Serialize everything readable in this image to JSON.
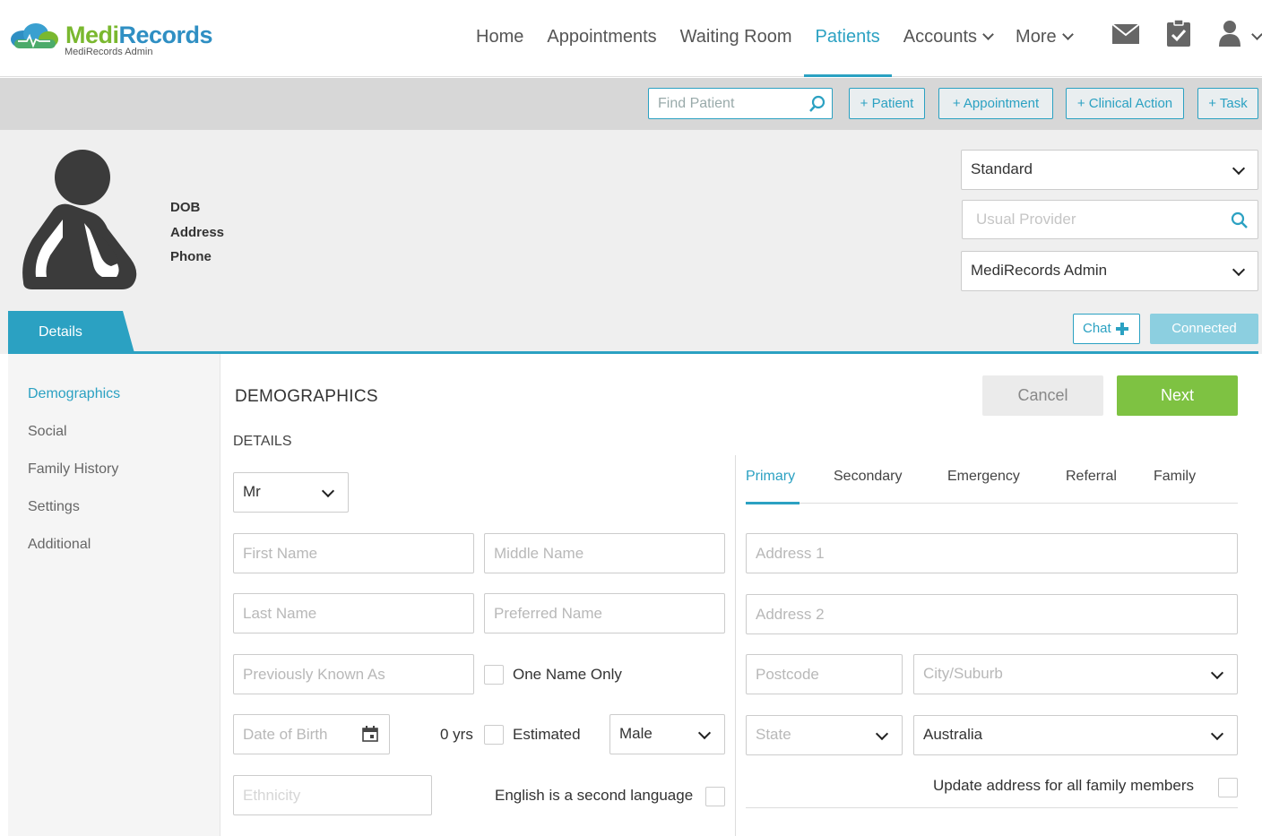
{
  "brand": {
    "name_part1": "Medi",
    "name_part2": "Records",
    "subtitle": "MediRecords Admin"
  },
  "nav": {
    "home": "Home",
    "appointments": "Appointments",
    "waiting_room": "Waiting Room",
    "patients": "Patients",
    "accounts": "Accounts",
    "more": "More",
    "active": "Patients"
  },
  "actions": {
    "find_placeholder": "Find Patient",
    "add_patient": "+ Patient",
    "add_appointment": "+ Appointment",
    "add_clinical_action": "+ Clinical Action",
    "add_task": "+ Task"
  },
  "patient": {
    "dob_label": "DOB",
    "address_label": "Address",
    "phone_label": "Phone",
    "type_select": "Standard",
    "usual_provider_placeholder": "Usual Provider",
    "practice_select": "MediRecords Admin"
  },
  "tabs": {
    "details": "Details"
  },
  "chat": {
    "label": "Chat",
    "connected": "Connected"
  },
  "sidenav": [
    "Demographics",
    "Social",
    "Family History",
    "Settings",
    "Additional"
  ],
  "form": {
    "heading": "DEMOGRAPHICS",
    "subheading": "DETAILS",
    "cancel": "Cancel",
    "next": "Next",
    "title_select": "Mr",
    "first_name_ph": "First Name",
    "middle_name_ph": "Middle Name",
    "last_name_ph": "Last Name",
    "preferred_name_ph": "Preferred Name",
    "previously_known_ph": "Previously Known As",
    "one_name_only": "One Name Only",
    "dob_ph": "Date of Birth",
    "age": "0 yrs",
    "estimated": "Estimated",
    "gender_select": "Male",
    "ethnicity_ph": "Ethnicity",
    "english_second": "English is a second language"
  },
  "address": {
    "tabs": [
      "Primary",
      "Secondary",
      "Emergency",
      "Referral",
      "Family"
    ],
    "address1_ph": "Address 1",
    "address2_ph": "Address 2",
    "postcode_ph": "Postcode",
    "city_ph": "City/Suburb",
    "state_ph": "State",
    "country_select": "Australia",
    "update_family": "Update address for all family members"
  },
  "colors": {
    "accent": "#2ba1c2",
    "green": "#7ec242",
    "brand_green": "#7ab82f",
    "brand_blue": "#2f8fc3"
  },
  "icons": {
    "mail": "mail-icon",
    "clipboard": "clipboard-check-icon",
    "user": "user-icon",
    "search": "search-icon",
    "calendar": "calendar-icon"
  }
}
